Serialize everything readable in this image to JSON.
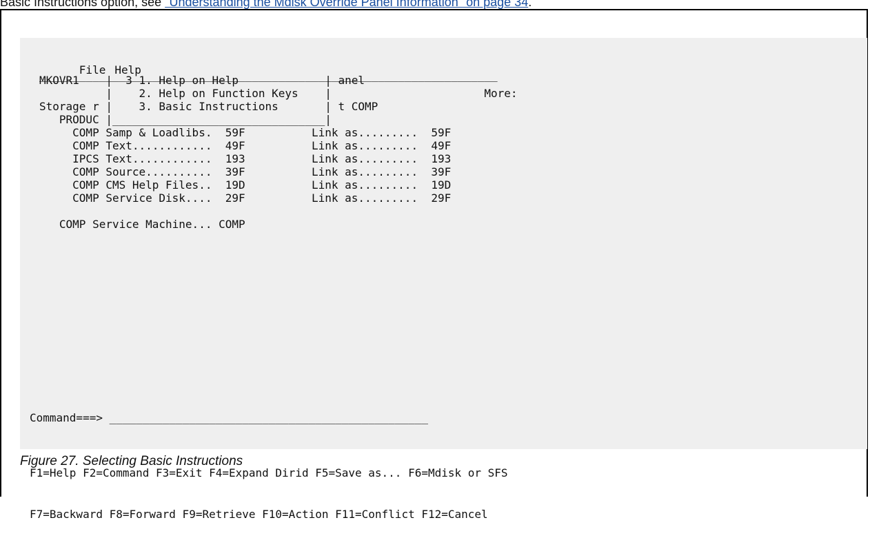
{
  "intro_text": {
    "before": "Basic Instructions option, see ",
    "link": "\"Understanding the Mdisk Override Panel Information\" on page 34",
    "after": "."
  },
  "menu": {
    "file": "File",
    "help": "Help"
  },
  "screen_lines": [
    "_____________________________________________________________________",
    "MKOVR1    |  3 1. Help on Help             | anel",
    "          |    2. Help on Function Keys    |                       More:",
    "Storage r |    3. Basic Instructions       | t COMP",
    "   PRODUC |________________________________|",
    "     COMP Samp & Loadlibs.  59F          Link as.........  59F",
    "     COMP Text............  49F          Link as.........  49F",
    "     IPCS Text............  193          Link as.........  193",
    "     COMP Source..........  39F          Link as.........  39F",
    "     COMP CMS Help Files..  19D          Link as.........  19D",
    "     COMP Service Disk....  29F          Link as.........  29F",
    "",
    "   COMP Service Machine... COMP"
  ],
  "command": {
    "label": "Command===>",
    "field": " ________________________________________________"
  },
  "fkeys": [
    "F1=Help F2=Command F3=Exit F4=Expand Dirid F5=Save as... F6=Mdisk or SFS",
    "F7=Backward F8=Forward F9=Retrieve F10=Action F11=Conflict F12=Cancel"
  ],
  "caption": "Figure 27. Selecting Basic Instructions"
}
